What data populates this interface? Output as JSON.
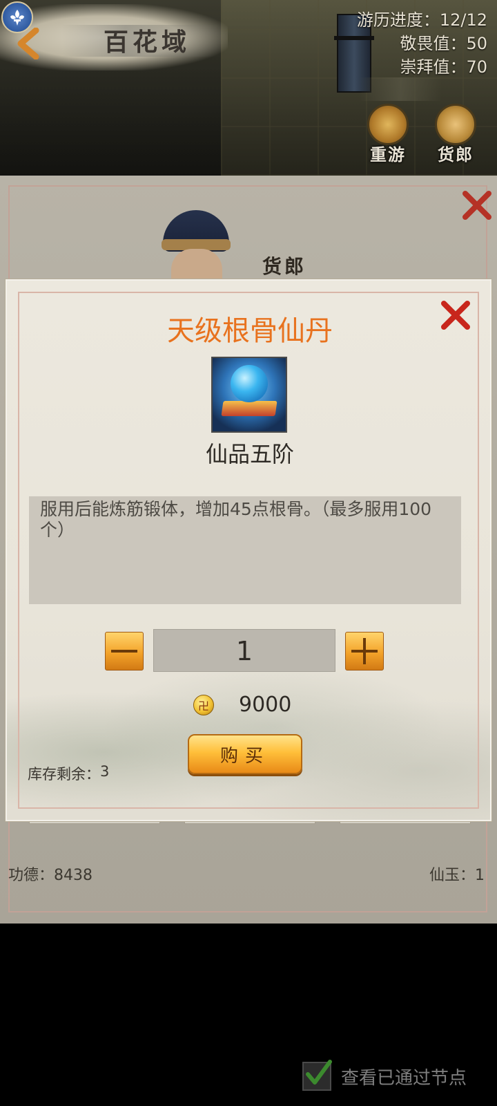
{
  "scene": {
    "title": "百花域",
    "stats": [
      {
        "label": "游历进度：",
        "value": "12/12"
      },
      {
        "label": "敬畏值：",
        "value": "50"
      },
      {
        "label": "崇拜值：",
        "value": "70"
      }
    ],
    "buttons": [
      {
        "label": "重游"
      },
      {
        "label": "货郎"
      }
    ]
  },
  "merchant": {
    "name": "货郎",
    "currency_left": {
      "label": "功德：",
      "value": "8438"
    },
    "currency_right": {
      "label": "仙玉：",
      "value": "1"
    }
  },
  "dialog": {
    "title": "天级根骨仙丹",
    "grade": "仙品五阶",
    "description": "服用后能炼筋锻体，增加45点根骨。（最多服用100个）",
    "quantity": "1",
    "coin_glyph": "卍",
    "price": "9000",
    "buy_label": "购买",
    "stock_label": "库存剩余：",
    "stock_value": "3"
  },
  "footer": {
    "checkbox_label": "查看已通过节点",
    "checkbox_checked": true
  },
  "colors": {
    "title_orange": "#e8721e",
    "button_gold": "#f3a32a",
    "close_red": "#c8261c",
    "check_green": "#3c8a2e"
  }
}
